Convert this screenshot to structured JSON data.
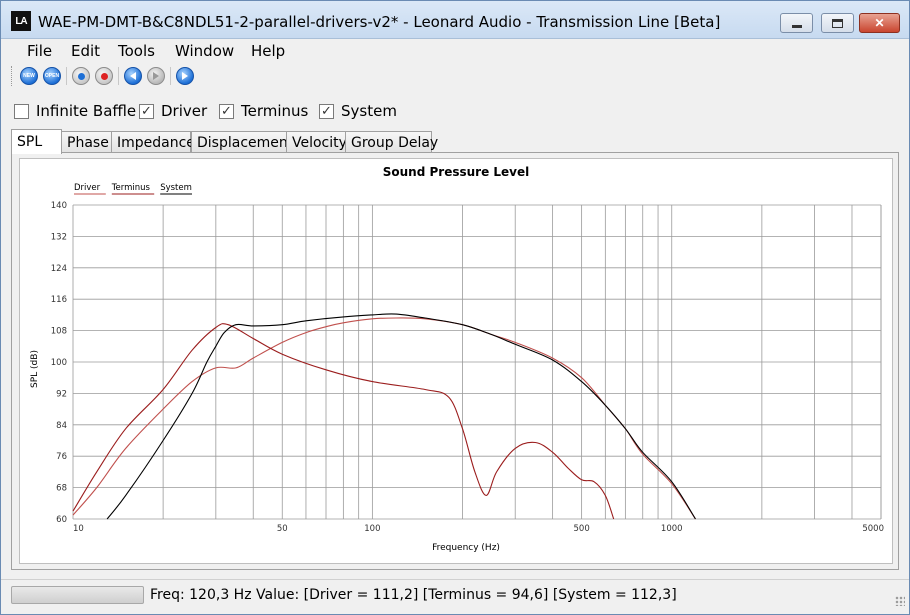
{
  "window": {
    "title": "WAE-PM-DMT-B&C8NDL51-2-parallel-drivers-v2* - Leonard Audio - Transmission Line [Beta]",
    "logo": "LA",
    "controls": [
      "minimize-icon",
      "maximize-icon",
      "close-icon"
    ]
  },
  "menu": [
    "File",
    "Edit",
    "Tools",
    "Window",
    "Help"
  ],
  "toolbar": {
    "buttons": [
      {
        "label": "NEW",
        "icon": "new-icon"
      },
      {
        "label": "OPEN",
        "icon": "open-icon"
      },
      {
        "label": "",
        "icon": "record-blue-icon"
      },
      {
        "label": "",
        "icon": "record-red-icon"
      },
      {
        "label": "",
        "icon": "step-back-icon"
      },
      {
        "label": "",
        "icon": "step-forward-icon"
      },
      {
        "label": "",
        "icon": "play-icon"
      }
    ]
  },
  "options": [
    {
      "label": "Infinite Baffle",
      "checked": false
    },
    {
      "label": "Driver",
      "checked": true
    },
    {
      "label": "Terminus",
      "checked": true
    },
    {
      "label": "System",
      "checked": true
    }
  ],
  "tabs": [
    "SPL",
    "Phase",
    "Impedance",
    "Displacement",
    "Velocity",
    "Group Delay"
  ],
  "active_tab": "SPL",
  "chart_data": {
    "type": "line",
    "title": "Sound Pressure Level",
    "xlabel": "Frequency (Hz)",
    "ylabel": "SPL (dB)",
    "x_scale": "log",
    "xlim": [
      10,
      5000
    ],
    "ylim": [
      60,
      140
    ],
    "x_ticks": [
      10,
      50,
      100,
      500,
      1000,
      5000
    ],
    "y_ticks": [
      60,
      68,
      76,
      84,
      92,
      100,
      108,
      116,
      124,
      132,
      140
    ],
    "legend": [
      "Driver",
      "Terminus",
      "System"
    ],
    "legend_position": "top-left",
    "grid": true,
    "series": [
      {
        "name": "Driver",
        "color": "#c0504d",
        "x": [
          10,
          12,
          15,
          20,
          25,
          30,
          35,
          40,
          50,
          60,
          70,
          80,
          100,
          120,
          150,
          200,
          250,
          300,
          400,
          500,
          600,
          700,
          800,
          1000,
          1200
        ],
        "y": [
          61,
          68,
          78,
          88,
          95,
          98.5,
          98.5,
          101,
          105,
          107.5,
          109,
          110,
          111,
          111.2,
          111,
          109.5,
          107,
          105,
          101,
          96,
          89,
          83,
          76.5,
          69,
          60
        ]
      },
      {
        "name": "Terminus",
        "color": "#9b1d1d",
        "x": [
          10,
          12,
          15,
          20,
          25,
          30,
          33,
          40,
          50,
          70,
          100,
          150,
          180,
          200,
          220,
          240,
          260,
          300,
          350,
          400,
          450,
          500,
          550,
          600,
          640
        ],
        "y": [
          62,
          72,
          83,
          93,
          103,
          108.8,
          109.5,
          106,
          102,
          98,
          95,
          93,
          91,
          83,
          72,
          66,
          72,
          78,
          79.5,
          77,
          73,
          70,
          69.5,
          66,
          60
        ]
      },
      {
        "name": "System",
        "color": "#000000",
        "x": [
          13,
          15,
          20,
          25,
          28,
          30,
          32,
          35,
          40,
          50,
          60,
          80,
          100,
          120,
          150,
          200,
          250,
          300,
          400,
          500,
          600,
          700,
          800,
          1000,
          1200
        ],
        "y": [
          60,
          66,
          80,
          92,
          100,
          104,
          107.5,
          109.5,
          109.2,
          109.5,
          110.5,
          111.5,
          112,
          112.2,
          111.2,
          109.5,
          107,
          104.5,
          100.5,
          95,
          89,
          83,
          77,
          69.5,
          60
        ]
      }
    ]
  },
  "status": {
    "progress": 0,
    "text": "Freq: 120,3 Hz   Value: [Driver = 111,2]  [Terminus = 94,6]  [System = 112,3]"
  }
}
